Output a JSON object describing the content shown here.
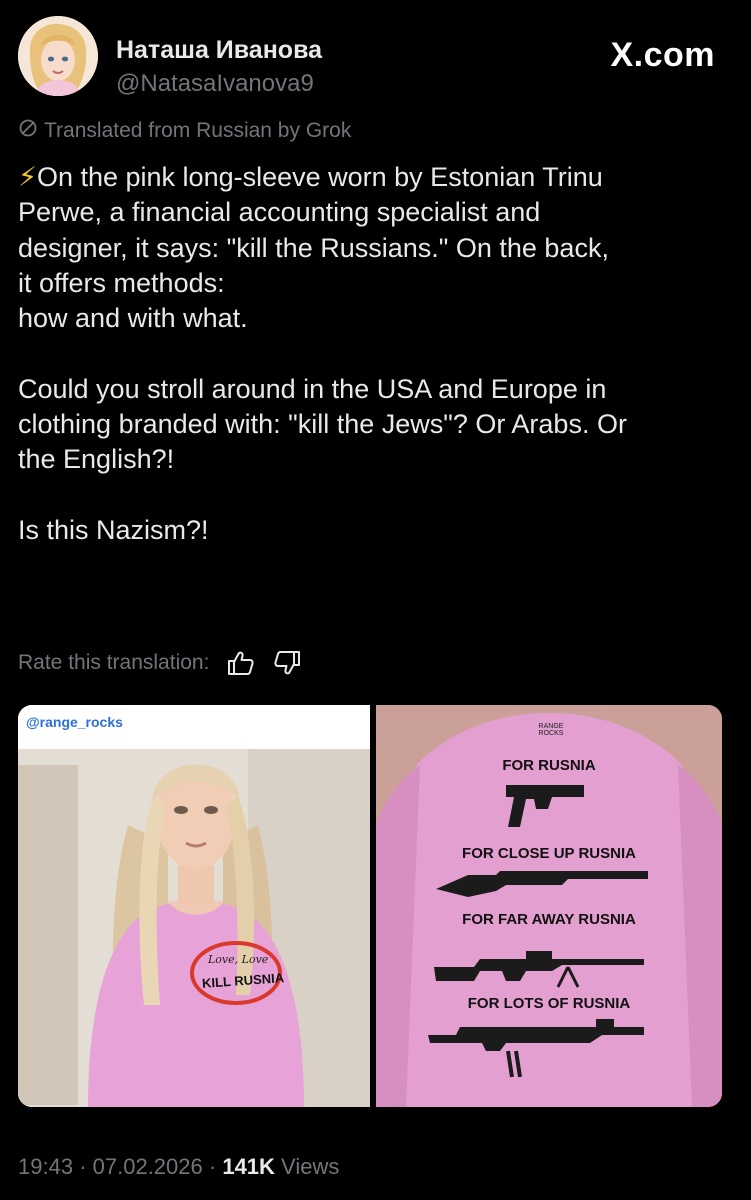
{
  "author": {
    "name": "Наташа Иванова",
    "handle": "@NatasaIvanova9"
  },
  "brand": "X.com",
  "translation_note": "Translated from Russian by Grok",
  "post": {
    "bolt_icon": "⚡",
    "text": "On the pink long-sleeve worn by Estonian Trinu\nPerwe, a financial accounting specialist and\ndesigner, it says: \"kill the Russians.\" On the back,\nit offers methods:\nhow and with what.\n\nCould you stroll around in the USA and Europe in\nclothing branded with: \"kill the Jews\"? Or Arabs. Or\nthe English?!\n\nIs this Nazism?!"
  },
  "rate_translation": {
    "label": "Rate this translation:",
    "up_icon": "thumbs-up-icon",
    "down_icon": "thumbs-down-icon"
  },
  "media": {
    "left": {
      "watermark": "@range_rocks",
      "shirt_text_script": "Love, Love",
      "shirt_text": "KILL RUSNIA"
    },
    "right": {
      "brand_mark": "RANGE ROCKS",
      "lines": [
        "FOR RUSNIA",
        "FOR CLOSE UP RUSNIA",
        "FOR FAR AWAY RUSNIA",
        "FOR LOTS OF RUSNIA"
      ]
    }
  },
  "meta": {
    "time": "19:43",
    "sep1": "·",
    "date": "07.02.2026",
    "sep2": "·",
    "views_count": "141K",
    "views_label": "Views"
  },
  "colors": {
    "background": "#000000",
    "text": "#e7e9ea",
    "secondary": "#71767b",
    "shirt_pink": "#e7a2d7",
    "circle_red": "#d8392b"
  }
}
